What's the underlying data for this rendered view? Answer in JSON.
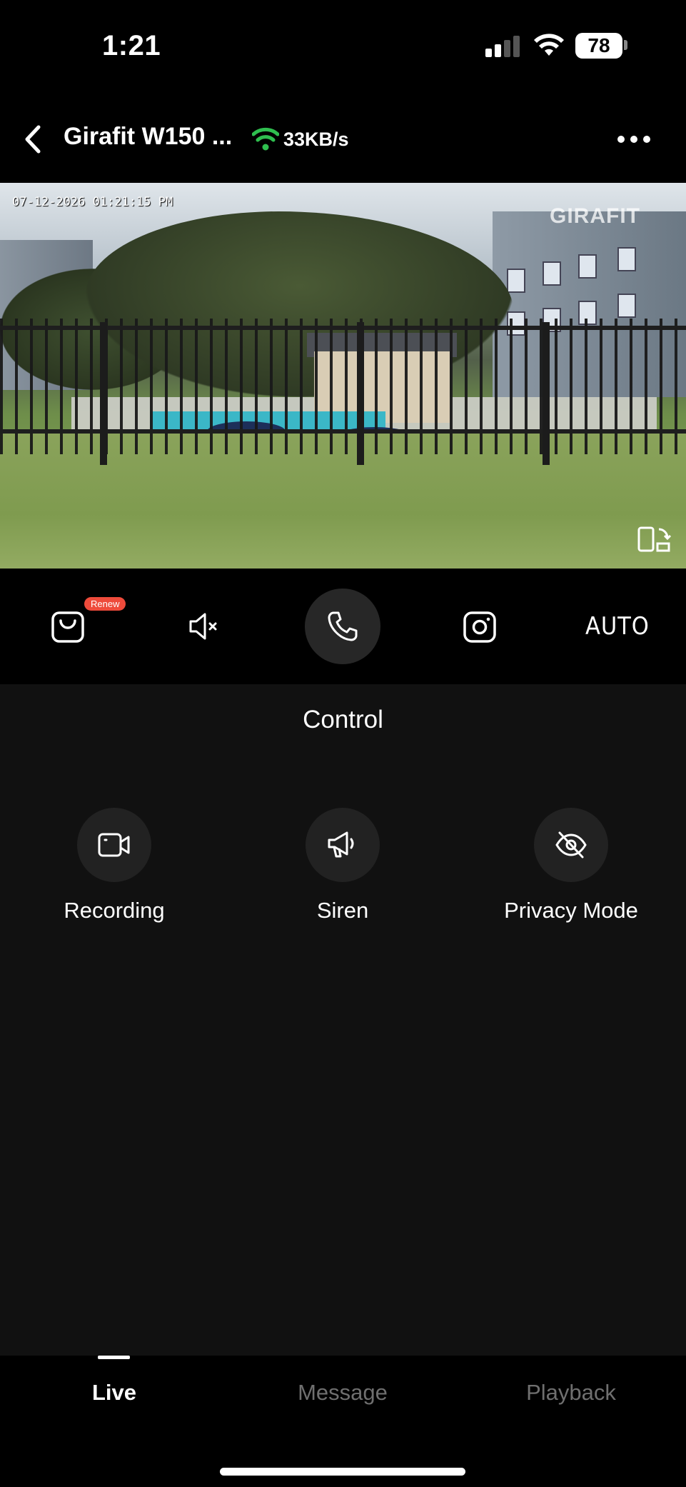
{
  "status_bar": {
    "time": "1:21",
    "battery": "78"
  },
  "header": {
    "title": "Girafit W150 ...",
    "speed": "33KB/s",
    "wifi_color": "#2fbf4f"
  },
  "video": {
    "timestamp": "07-12-2026 01:21:15 PM",
    "watermark": "GIRAFIT"
  },
  "toolbar": {
    "renew_badge": "Renew",
    "quality": "AUTO",
    "icons": [
      "cloud-bag-icon",
      "mute-icon",
      "phone-icon",
      "camera-icon"
    ]
  },
  "control": {
    "title": "Control",
    "items": [
      {
        "label": "Recording",
        "icon": "video-camera-icon"
      },
      {
        "label": "Siren",
        "icon": "megaphone-icon"
      },
      {
        "label": "Privacy Mode",
        "icon": "eye-off-icon"
      }
    ]
  },
  "tabs": [
    {
      "label": "Live",
      "active": true
    },
    {
      "label": "Message",
      "active": false
    },
    {
      "label": "Playback",
      "active": false
    }
  ],
  "colors": {
    "accent_badge": "#ee4b3b",
    "panel_bg": "#111111",
    "inactive_tab": "#6f6f6f"
  }
}
